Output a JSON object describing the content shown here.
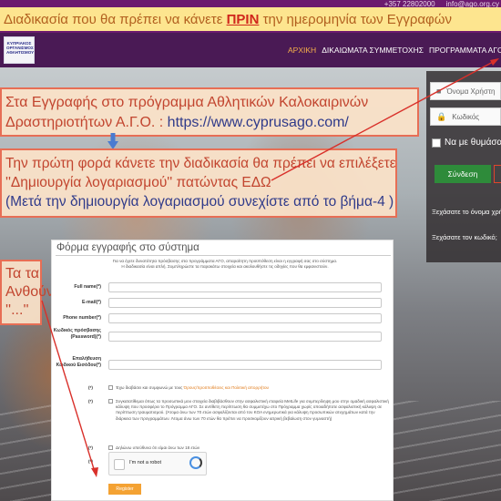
{
  "banner": {
    "text_before": "Διαδικασία που θα πρέπει να κάνετε ",
    "text_strong": "ΠΡΙΝ",
    "text_after": " την ημερομηνία των Εγγραφών"
  },
  "site": {
    "topbar": {
      "phone": "+357 22802000",
      "email": "info@ago.org.cy"
    },
    "logo_text": "ΚΥΠΡΙΑΚΟΣ ΟΡΓΑΝΙΣΜΟΣ ΑΘΛΗΤΙΣΜΟΥ",
    "nav": {
      "items": [
        "ΑΡΧΙΚΗ",
        "ΔΙΚΑΙΩΜΑΤΑ ΣΥΜΜΕΤΟΧΗΣ",
        "ΠΡΟΓΡΑΜΜΑΤΑ ΑΓΟ"
      ]
    },
    "login": {
      "username_placeholder": "Όνομα Χρήστη",
      "password_placeholder": "Κωδικός",
      "remember_label": "Να με θυμάσαι",
      "login_button": "Σύνδεση",
      "forgot_username": "Ξεχάσατε το όνομα χρήστη;",
      "forgot_password": "Ξεχάσατε τον κωδικό;"
    }
  },
  "callouts": {
    "step1_line1": "Στα Εγγραφής στο πρόγραμμα Αθλητικών Καλοκαιρινών",
    "step1_line2_a": "Δραστηριοτήτων  Α.Γ.Ο. : ",
    "step1_url": "https://www.cyprusago.com/",
    "step2_line1": "Την πρώτη φορά κάνετε την διαδικασία θα πρέπει να επιλέξετε",
    "step2_line2": "''Δημιουργία λογαριασμού'' πατώντας ΕΔΩ",
    "step2_line3": "(Μετά την δημιουργία λογαριασμού συνεχίστε από το βήμα-4 )",
    "step3_line1": "Τα τα",
    "step3_line2": "Ανθούν",
    "step3_line3": "''...''"
  },
  "form": {
    "title": "Φόρμα εγγραφής στο σύστημα",
    "intro_line1": "Για να έχετε δυνατότητα πρόσβασης στα προγράμματα ΑΓΟ, απαραίτητη προϋπόθεση είναι η εγγραφή σας στο σύστημα.",
    "intro_line2": "Η διαδικασία είναι απλή. Συμπληρώστε τα παρακάτω στοιχεία και ακολουθήστε τις οδηγίες που θα εμφανιστούν.",
    "fields": [
      {
        "label": "Full name(*)"
      },
      {
        "label": "E-mail(*)"
      },
      {
        "label": "Phone number(*)"
      },
      {
        "label": "Κωδικός πρόσβασης (Password)(*)"
      },
      {
        "label": "Επαλήθευση Κωδικού Εισόδου(*)"
      }
    ],
    "check1_star": "(*)",
    "check1_text": "Έχω διαβάσει και συμφωνώ με τους ",
    "check1_link": "Όρους/προϋποθέσεις και Πολιτική απορρήτου",
    "check2_star": "(*)",
    "check2_text": "Συγκατατίθεμαι όπως τα προσωπικά μου στοιχεία διαβιβάσθουν στην ασφαλιστική εταιρεία MetLife για συμπερίληψη μου στην ομαδική ασφαλιστική κάλυψη που προσφέρει το Πρόγραμμα ΑΓΟ. Σε αντίθετη περίπτωση θα συμμετέχω στο Πρόγραμμα χωρίς οποιαδήποτε ασφαλιστική κάλυψη σε περίπτωση τραυματισμού. (Άτομα άνω των 70 ετών ασφαλίζονται από τον ΚΟΑ ενημερωτικά για κάλυψη προσωπικών ατυχημάτων κατά την διάρκεια των προγραμμάτων. Άτομα άνω των 70 ετών θα πρέπει να προσκομίζουν ιατρική βεβαίωση στον γυμναστή)",
    "check3_star": "(*)",
    "check3_text": "Δηλώνω υπεύθυνα ότι είμαι άνω των 18 ετών",
    "captcha_star": "(*)",
    "captcha_text": "I'm not a robot",
    "register_button": "Register"
  },
  "colors": {
    "banner_bg": "#fde58f",
    "callout_border": "#e76e55",
    "nav_bg": "#4a1a55",
    "login_button": "#2e8b3a",
    "register_button": "#f4a233"
  }
}
